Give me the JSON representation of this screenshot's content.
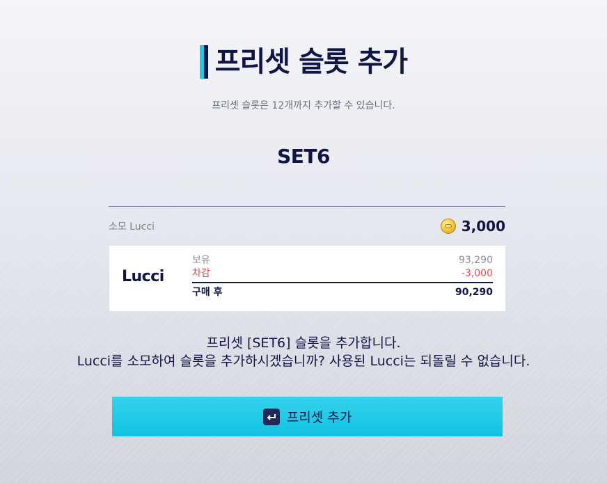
{
  "dialog": {
    "title": "프리셋 슬롯 추가",
    "subtitle": "프리셋 슬롯은 12개까지 추가할 수 있습니다.",
    "set_name": "SET6"
  },
  "cost": {
    "label": "소모 Lucci",
    "value": "3,000",
    "icon": "coin-icon"
  },
  "summary": {
    "currency": "Lucci",
    "rows": [
      {
        "label": "보유",
        "value": "93,290"
      },
      {
        "label": "차감",
        "value": "-3,000"
      }
    ],
    "after": {
      "label": "구매 후",
      "value": "90,290"
    }
  },
  "message": {
    "line1": "프리셋 [SET6] 슬롯을 추가합니다.",
    "line2": "Lucci를 소모하여 슬롯을 추가하시겠습니까? 사용된 Lucci는 되돌릴 수 없습니다."
  },
  "confirm": {
    "label": "프리셋 추가",
    "icon": "enter-key-icon"
  },
  "colors": {
    "navy": "#0f1646",
    "accent": "#22c9e6",
    "deduct": "#e8474d",
    "coin": "#f3cf45"
  }
}
